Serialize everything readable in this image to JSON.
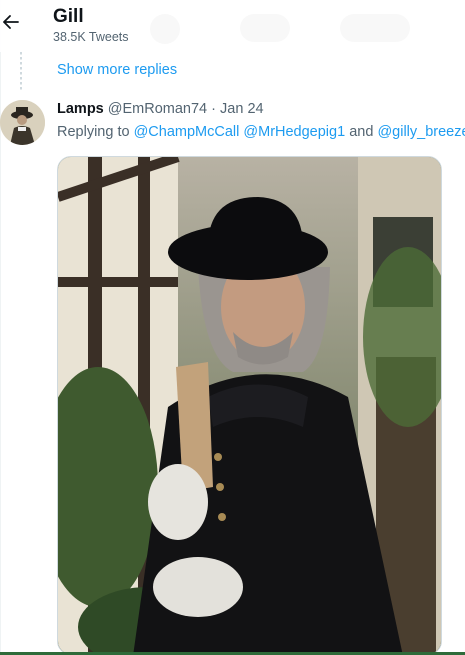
{
  "header": {
    "back_icon": "arrow-left-icon",
    "title": "Gill",
    "subtitle": "38.5K Tweets"
  },
  "thread": {
    "show_more_label": "Show more replies"
  },
  "tweet": {
    "display_name": "Lamps",
    "handle": "@EmRoman74",
    "separator": "·",
    "date": "Jan 24",
    "replying_prefix": "Replying to",
    "mentions": [
      "@ChampMcCall",
      "@MrHedgepig1"
    ],
    "conjunction": "and",
    "last_mention": "@gilly_breeze",
    "media_description": "photo"
  },
  "colors": {
    "accent": "#1d9bf0",
    "muted": "#536471",
    "text": "#0f1419"
  }
}
